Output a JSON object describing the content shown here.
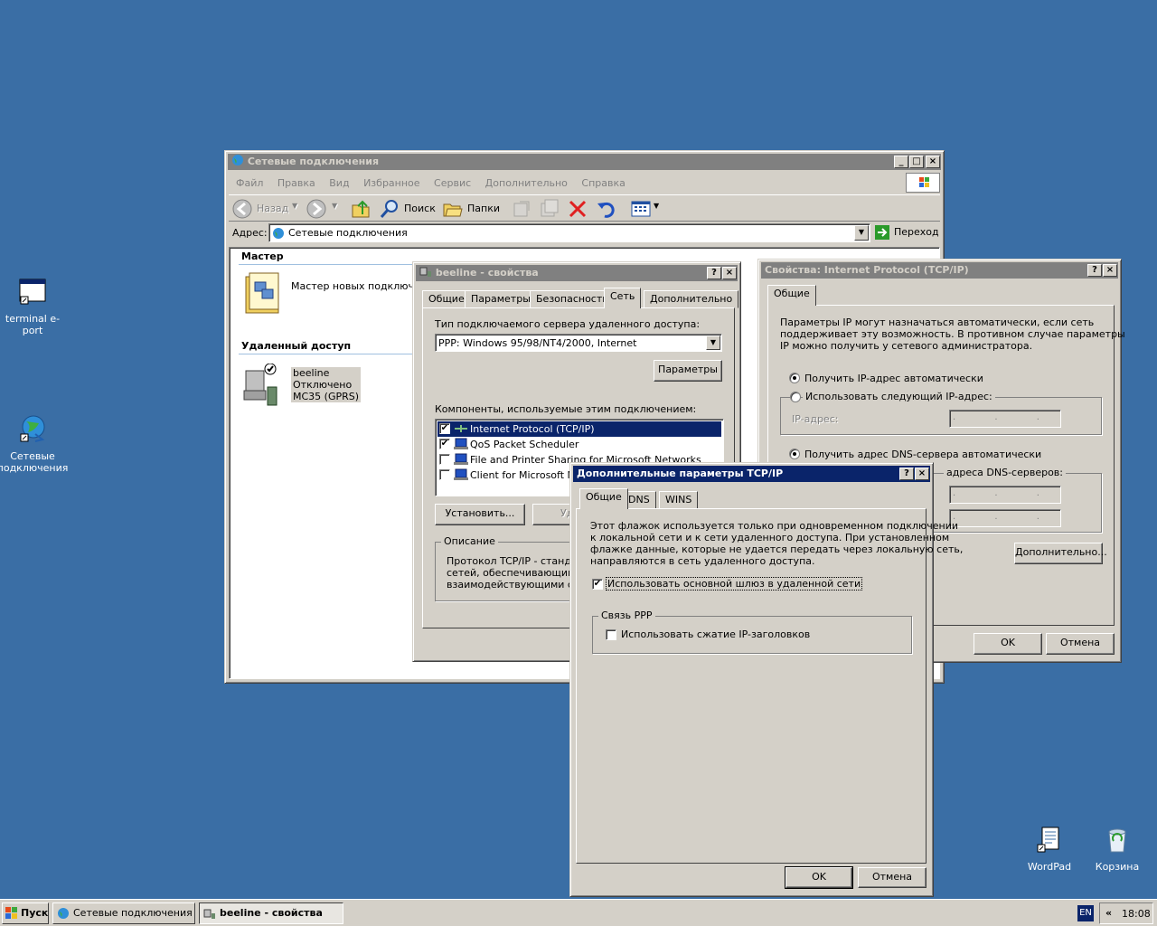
{
  "desktop": {
    "icons": [
      {
        "label": "terminal e-port"
      },
      {
        "label": "Сетевые подключения"
      },
      {
        "label": "WordPad"
      },
      {
        "label": "Корзина"
      }
    ]
  },
  "explorer": {
    "title": "Сетевые подключения",
    "menu": [
      "Файл",
      "Правка",
      "Вид",
      "Избранное",
      "Сервис",
      "Дополнительно",
      "Справка"
    ],
    "toolbar": {
      "back": "Назад",
      "search": "Поиск",
      "folders": "Папки"
    },
    "address": {
      "label": "Адрес:",
      "value": "Сетевые подключения",
      "go": "Переход"
    },
    "groups": [
      {
        "title": "Мастер",
        "items": [
          {
            "name": "Мастер новых подключений"
          }
        ]
      },
      {
        "title": "Удаленный доступ",
        "items": [
          {
            "name": "beeline",
            "status": "Отключено",
            "device": "MC35 (GPRS)"
          }
        ]
      }
    ]
  },
  "beeline_props": {
    "title": "beeline - свойства",
    "tabs": [
      "Общие",
      "Параметры",
      "Безопасность",
      "Сеть",
      "Дополнительно"
    ],
    "selected_tab": "Сеть",
    "server_type_label": "Тип подключаемого сервера удаленного доступа:",
    "server_type_value": "PPP: Windows 95/98/NT4/2000, Internet",
    "params_button": "Параметры",
    "components_label": "Компоненты, используемые этим подключением:",
    "components": [
      {
        "name": "Internet Protocol (TCP/IP)",
        "checked": true,
        "selected": true
      },
      {
        "name": "QoS Packet Scheduler",
        "checked": true
      },
      {
        "name": "File and Printer Sharing for Microsoft Networks",
        "checked": false
      },
      {
        "name": "Client for Microsoft Networks",
        "checked": false
      }
    ],
    "install_button": "Установить...",
    "remove_button_partial": "Уд",
    "description_group": "Описание",
    "description_lines": [
      "Протокол TCP/IP - стандар",
      "сетей, обеспечивающий св",
      "взаимодействующими сет"
    ]
  },
  "tcpip_props": {
    "title": "Свойства: Internet Protocol (TCP/IP)",
    "tab": "Общие",
    "intro_lines": [
      "Параметры IP могут назначаться автоматически, если сеть",
      "поддерживает эту возможность. В противном случае параметры",
      "IP можно получить у сетевого администратора."
    ],
    "radio_auto_ip": "Получить IP-адрес автоматически",
    "radio_manual_ip": "Использовать следующий IP-адрес:",
    "ip_label": "IP-адрес:",
    "radio_auto_dns": "Получить адрес DNS-сервера автоматически",
    "radio_manual_dns_partial": "адреса DNS-серверов:",
    "advanced_button": "Дополнительно...",
    "ok": "OK",
    "cancel": "Отмена"
  },
  "advanced_tcpip": {
    "title": "Дополнительные параметры TCP/IP",
    "tabs": [
      "Общие",
      "DNS",
      "WINS"
    ],
    "info_lines": [
      "Этот флажок используется только при одновременном подключении",
      "к локальной сети и к сети удаленного доступа. При установленном",
      "флажке данные, которые не удается передать через локальную сеть,",
      "направляются в сеть удаленного доступа."
    ],
    "use_gateway": {
      "label": "Использовать основной шлюз в удаленной сети",
      "checked": true
    },
    "ppp_group": "Связь PPP",
    "ip_compression": {
      "label": "Использовать сжатие IP-заголовков",
      "checked": false
    },
    "ok": "OK",
    "cancel": "Отмена"
  },
  "taskbar": {
    "start": "Пуск",
    "buttons": [
      {
        "label": "Сетевые подключения",
        "pressed": false
      },
      {
        "label": "beeline - свойства",
        "pressed": true
      }
    ],
    "lang": "EN",
    "clock": "18:08",
    "chevron": "«"
  }
}
